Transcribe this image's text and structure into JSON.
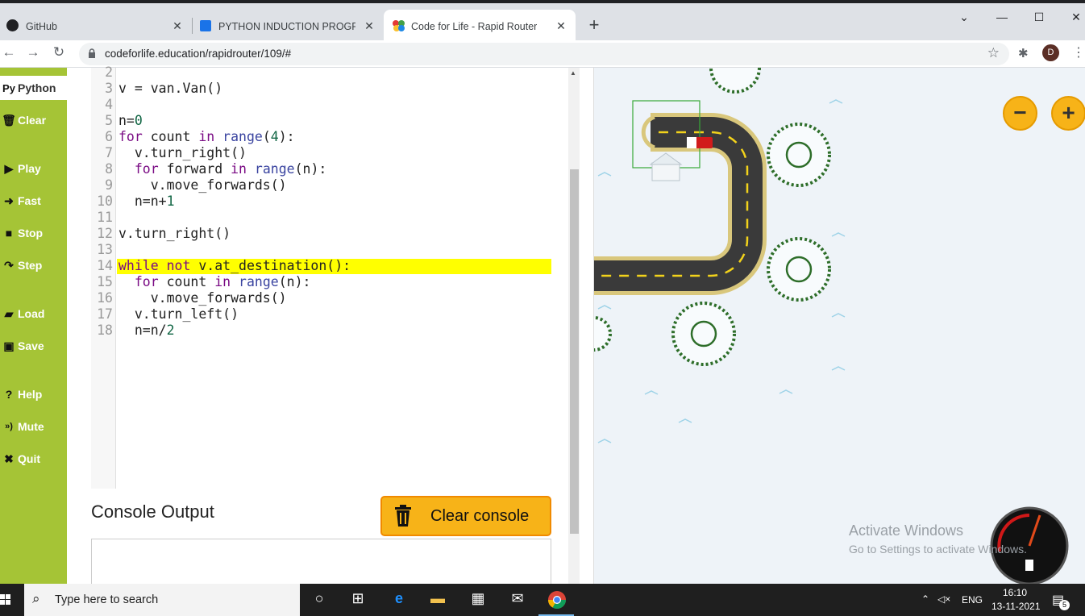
{
  "browser": {
    "tabs": [
      {
        "title": "GitHub",
        "icon": "github-icon"
      },
      {
        "title": "PYTHON INDUCTION PROGRAM",
        "icon": "classroom-icon"
      },
      {
        "title": "Code for Life - Rapid Router",
        "icon": "codeforlife-icon",
        "active": true
      }
    ],
    "url": "codeforlife.education/rapidrouter/109/#",
    "profile_initial": "D"
  },
  "sidebar": {
    "items": [
      {
        "label": "Python",
        "icon": "python-icon",
        "glyph": "Py",
        "active": true
      },
      {
        "label": "Clear",
        "icon": "trash-icon",
        "glyph": "🗑"
      },
      {
        "label": "Play",
        "icon": "play-icon",
        "glyph": "▶"
      },
      {
        "label": "Fast",
        "icon": "fast-forward-icon",
        "glyph": "➜"
      },
      {
        "label": "Stop",
        "icon": "stop-icon",
        "glyph": "■"
      },
      {
        "label": "Step",
        "icon": "step-icon",
        "glyph": "↷"
      },
      {
        "label": "Load",
        "icon": "folder-icon",
        "glyph": "▰"
      },
      {
        "label": "Save",
        "icon": "save-icon",
        "glyph": "▣"
      },
      {
        "label": "Help",
        "icon": "help-icon",
        "glyph": "?"
      },
      {
        "label": "Mute",
        "icon": "speaker-icon",
        "glyph": "»)"
      },
      {
        "label": "Quit",
        "icon": "close-icon",
        "glyph": "✖"
      }
    ]
  },
  "editor": {
    "line_numbers": [
      "2",
      "3",
      "4",
      "5",
      "6",
      "7",
      "8",
      "9",
      "10",
      "11",
      "12",
      "13",
      "14",
      "15",
      "16",
      "17",
      "18"
    ],
    "highlighted_line": "14",
    "code": {
      "l2": "",
      "l3": "v = van.Van()",
      "l4": "",
      "l5_a": "n=",
      "l5_b": "0",
      "l6_a": "for",
      "l6_b": " count ",
      "l6_c": "in",
      "l6_d": " ",
      "l6_e": "range",
      "l6_f": "(",
      "l6_g": "4",
      "l6_h": "):",
      "l7": "  v.turn_right()",
      "l8_a": "  ",
      "l8_b": "for",
      "l8_c": " forward ",
      "l8_d": "in",
      "l8_e": " ",
      "l8_f": "range",
      "l8_g": "(n):",
      "l9": "    v.move_forwards()",
      "l10_a": "  n=n+",
      "l10_b": "1",
      "l11": "",
      "l12": "v.turn_right()",
      "l13": "",
      "l14_a": "while",
      "l14_b": " ",
      "l14_c": "not",
      "l14_d": " v.at_destination():",
      "l15_a": "  ",
      "l15_b": "for",
      "l15_c": " count ",
      "l15_d": "in",
      "l15_e": " ",
      "l15_f": "range",
      "l15_g": "(n):",
      "l16": "    v.move_forwards()",
      "l17": "  v.turn_left()",
      "l18_a": "  n=n/",
      "l18_b": "2"
    }
  },
  "console": {
    "title": "Console Output",
    "clear_label": "Clear console"
  },
  "game": {
    "zoom_out": "−",
    "zoom_in": "+",
    "watermark_title": "Activate Windows",
    "watermark_sub": "Go to Settings to activate Windows."
  },
  "taskbar": {
    "search_placeholder": "Type here to search",
    "language": "ENG",
    "time": "16:10",
    "date": "13-11-2021",
    "notification_count": "5"
  }
}
